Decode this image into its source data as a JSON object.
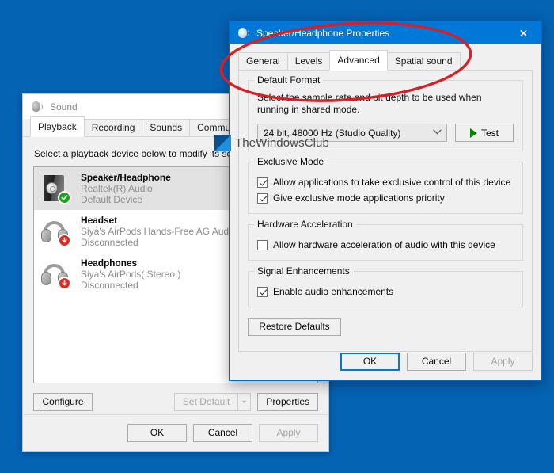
{
  "desktop": {
    "background_color": "#0563b4"
  },
  "sound_window": {
    "title": "Sound",
    "icon": "speaker-icon",
    "tabs": [
      {
        "label": "Playback",
        "active": true
      },
      {
        "label": "Recording",
        "active": false
      },
      {
        "label": "Sounds",
        "active": false
      },
      {
        "label": "Communications",
        "active": false
      }
    ],
    "hint": "Select a playback device below to modify its settings:",
    "devices": [
      {
        "name": "Speaker/Headphone",
        "driver": "Realtek(R) Audio",
        "status": "Default Device",
        "icon": "speaker-box-icon",
        "badge": "green-check-badge",
        "selected": true
      },
      {
        "name": "Headset",
        "driver": "Siya's AirPods Hands-Free AG Audio",
        "status": "Disconnected",
        "icon": "headphone-icon",
        "badge": "red-down-arrow-badge",
        "selected": false
      },
      {
        "name": "Headphones",
        "driver": "Siya's AirPods( Stereo )",
        "status": "Disconnected",
        "icon": "headphone-icon",
        "badge": "red-down-arrow-badge",
        "selected": false
      }
    ],
    "buttons": {
      "configure": "Configure",
      "set_default": "Set Default",
      "properties": "Properties",
      "ok": "OK",
      "cancel": "Cancel",
      "apply": "Apply"
    }
  },
  "properties_dialog": {
    "title": "Speaker/Headphone Properties",
    "icon": "speaker-icon",
    "close_icon": "close-icon",
    "title_bar_color": "#0078d7",
    "tabs": [
      {
        "label": "General",
        "active": false
      },
      {
        "label": "Levels",
        "active": false
      },
      {
        "label": "Advanced",
        "active": true
      },
      {
        "label": "Spatial sound",
        "active": false
      }
    ],
    "default_format": {
      "legend": "Default Format",
      "description": "Select the sample rate and bit depth to be used when running in shared mode.",
      "selected_value": "24 bit, 48000 Hz (Studio Quality)",
      "dropdown_icon": "chevron-down-icon",
      "test_label": "Test",
      "test_icon": "play-icon"
    },
    "exclusive_mode": {
      "legend": "Exclusive Mode",
      "options": [
        {
          "label": "Allow applications to take exclusive control of this device",
          "checked": true
        },
        {
          "label": "Give exclusive mode applications priority",
          "checked": true
        }
      ]
    },
    "hardware_acceleration": {
      "legend": "Hardware Acceleration",
      "options": [
        {
          "label": "Allow hardware acceleration of audio with this device",
          "checked": false
        }
      ]
    },
    "signal_enhancements": {
      "legend": "Signal Enhancements",
      "options": [
        {
          "label": "Enable audio enhancements",
          "checked": true
        }
      ]
    },
    "restore_defaults": "Restore Defaults",
    "buttons": {
      "ok": "OK",
      "cancel": "Cancel",
      "apply": "Apply"
    }
  },
  "annotation": {
    "type": "red-ellipse-highlight",
    "color": "#d81f26",
    "targets": "Advanced tab"
  },
  "watermark": {
    "text": "TheWindowsClub",
    "logo": "thewindowsclub-logo"
  }
}
